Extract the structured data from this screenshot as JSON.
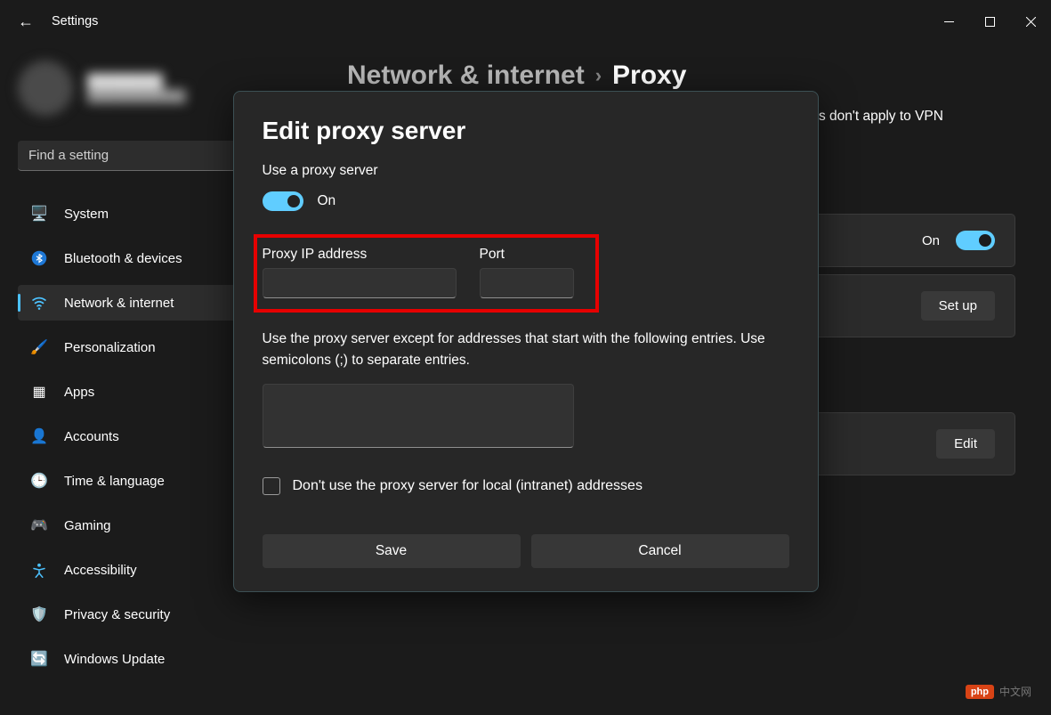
{
  "window": {
    "app_title": "Settings"
  },
  "search": {
    "placeholder": "Find a setting"
  },
  "sidebar": {
    "items": [
      {
        "label": "System",
        "icon": "🖥️",
        "name": "system"
      },
      {
        "label": "Bluetooth & devices",
        "icon": "bt",
        "name": "bluetooth-devices"
      },
      {
        "label": "Network & internet",
        "icon": "wifi",
        "name": "network-internet"
      },
      {
        "label": "Personalization",
        "icon": "🖌️",
        "name": "personalization"
      },
      {
        "label": "Apps",
        "icon": "▦",
        "name": "apps"
      },
      {
        "label": "Accounts",
        "icon": "👤",
        "name": "accounts"
      },
      {
        "label": "Time & language",
        "icon": "🕒",
        "name": "time-language"
      },
      {
        "label": "Gaming",
        "icon": "🎮",
        "name": "gaming"
      },
      {
        "label": "Accessibility",
        "icon": "acc",
        "name": "accessibility"
      },
      {
        "label": "Privacy & security",
        "icon": "🛡️",
        "name": "privacy-security"
      },
      {
        "label": "Windows Update",
        "icon": "🔄",
        "name": "windows-update"
      }
    ]
  },
  "breadcrumb": {
    "parent": "Network & internet",
    "current": "Proxy"
  },
  "background_note": "s don't apply to VPN",
  "cards": {
    "auto_on_label": "On",
    "setup_label": "Set up",
    "edit_label": "Edit"
  },
  "modal": {
    "title": "Edit proxy server",
    "use_label": "Use a proxy server",
    "on_label": "On",
    "ip_label": "Proxy IP address",
    "port_label": "Port",
    "ip_value": "",
    "port_value": "",
    "except_desc": "Use the proxy server except for addresses that start with the following entries. Use semicolons (;) to separate entries.",
    "except_value": "",
    "local_check": "Don't use the proxy server for local (intranet) addresses",
    "save_label": "Save",
    "cancel_label": "Cancel"
  },
  "watermark": {
    "badge": "php",
    "text": "中文网"
  }
}
